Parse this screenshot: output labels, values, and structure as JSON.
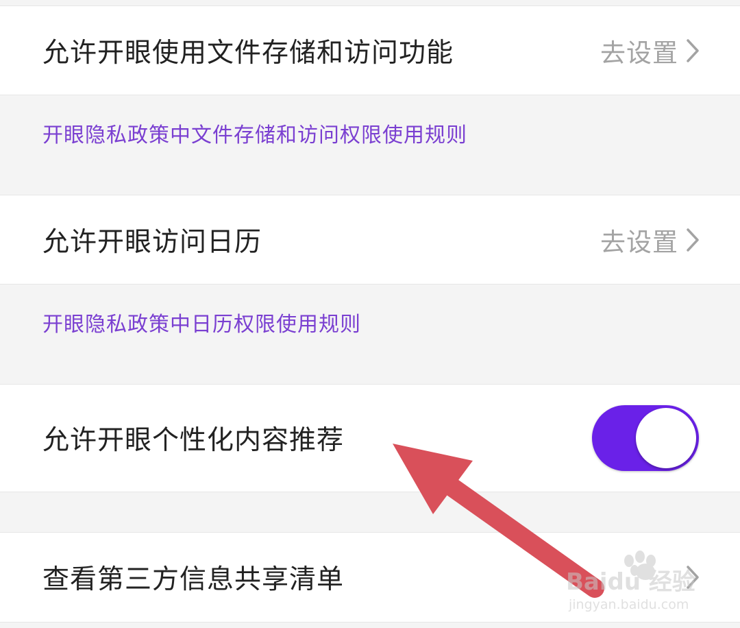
{
  "rows": {
    "file_storage": {
      "label": "允许开眼使用文件存储和访问功能",
      "action": "去设置"
    },
    "file_storage_policy": "开眼隐私政策中文件存储和访问权限使用规则",
    "calendar": {
      "label": "允许开眼访问日历",
      "action": "去设置"
    },
    "calendar_policy": "开眼隐私政策中日历权限使用规则",
    "personalized": {
      "label": "允许开眼个性化内容推荐",
      "toggle_state": "on"
    },
    "third_party": {
      "label": "查看第三方信息共享清单"
    }
  },
  "watermark": {
    "logo_text": "Baidu 经验",
    "url": "jingyan.baidu.com"
  },
  "colors": {
    "toggle_on": "#6a21e8",
    "link": "#7a3fd1",
    "annotation_arrow": "#d9505a"
  },
  "icons": [
    "chevron-right-icon",
    "annotation-arrow",
    "baidu-paw-icon"
  ]
}
